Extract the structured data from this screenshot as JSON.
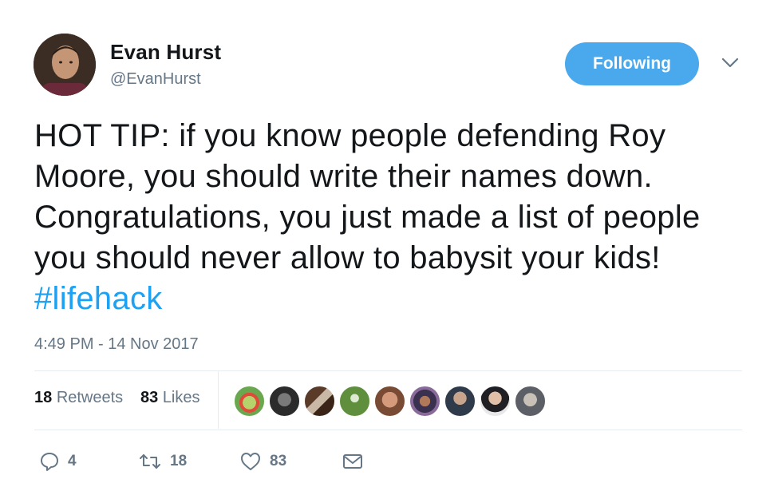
{
  "author": {
    "display_name": "Evan Hurst",
    "handle": "@EvanHurst"
  },
  "follow_button": {
    "label": "Following"
  },
  "tweet": {
    "text": "HOT TIP: if you know people defending Roy Moore, you should write their names down. Congratulations, you just made a list of people you should never allow to babysit your kids! ",
    "hashtag": "#lifehack",
    "timestamp": "4:49 PM - 14 Nov 2017"
  },
  "stats": {
    "retweets_count": "18",
    "retweets_label": "Retweets",
    "likes_count": "83",
    "likes_label": "Likes"
  },
  "actions": {
    "reply_count": "4",
    "retweet_count": "18",
    "like_count": "83"
  },
  "colors": {
    "accent": "#1da1f2",
    "follow_button": "#4aa8ec",
    "secondary_text": "#657786"
  },
  "icons": [
    "chevron-down-icon",
    "reply-icon",
    "retweet-icon",
    "heart-icon",
    "envelope-icon"
  ]
}
